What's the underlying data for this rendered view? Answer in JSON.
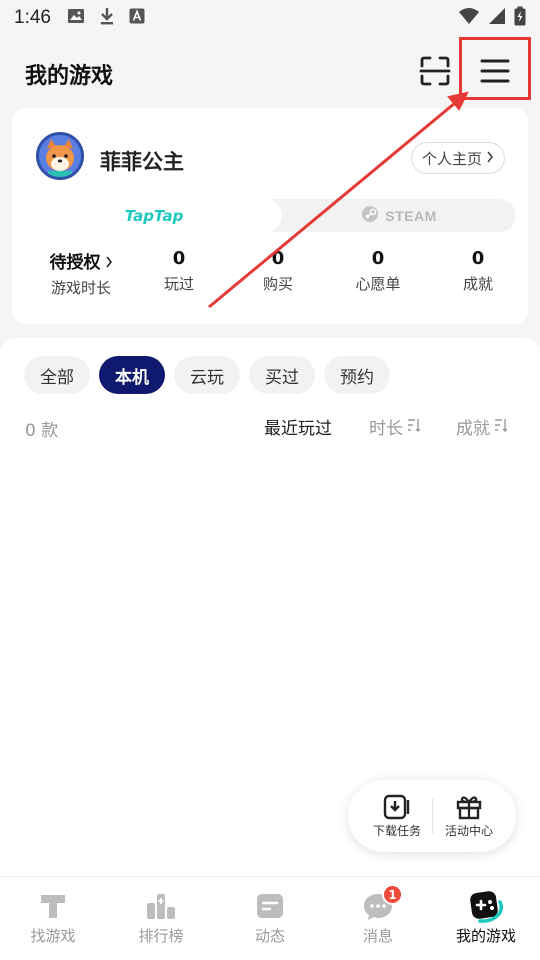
{
  "status_bar": {
    "time": "1:46"
  },
  "header": {
    "title": "我的游戏"
  },
  "profile": {
    "username": "菲菲公主",
    "homepage_button": "个人主页",
    "platforms": {
      "taptap": "TapTap",
      "steam": "STEAM"
    },
    "stats": [
      {
        "value": "待授权",
        "label": "游戏时长"
      },
      {
        "value": "0",
        "label": "玩过"
      },
      {
        "value": "0",
        "label": "购买"
      },
      {
        "value": "0",
        "label": "心愿单"
      },
      {
        "value": "0",
        "label": "成就"
      }
    ]
  },
  "filters": {
    "chips": [
      "全部",
      "本机",
      "云玩",
      "买过",
      "预约"
    ],
    "active": "本机"
  },
  "list": {
    "count": "0 款",
    "sort_options": [
      "最近玩过",
      "时长",
      "成就"
    ]
  },
  "floating": {
    "download": "下载任务",
    "activity": "活动中心"
  },
  "nav": {
    "items": [
      "找游戏",
      "排行榜",
      "动态",
      "消息",
      "我的游戏"
    ],
    "message_badge": "1",
    "active": "我的游戏"
  },
  "colors": {
    "accent_dark": "#0f1a6e",
    "taptap": "#1ec9c0",
    "annotation": "#e53935",
    "badge": "#f04a3a"
  }
}
